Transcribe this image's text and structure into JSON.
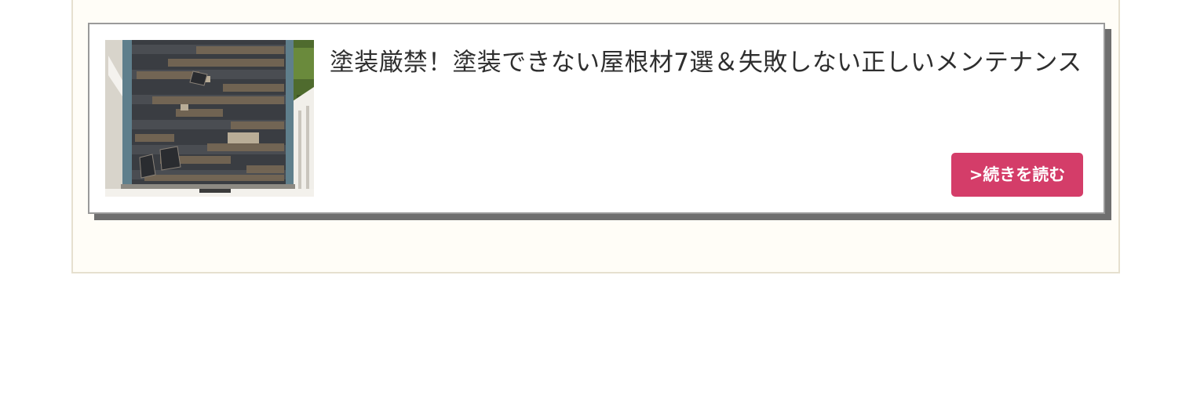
{
  "article_card": {
    "title": "塗装厳禁！塗装できない屋根材7選＆失敗しない正しいメンテナンス",
    "thumbnail_icon": "damaged-roof-photo",
    "read_more_label": ">続きを読む"
  },
  "colors": {
    "panel_bg": "#fffdf7",
    "panel_border": "#e6e0cf",
    "card_border": "#9a9a9a",
    "card_shadow": "#6f6f6f",
    "button_bg": "#d43d69",
    "title_text": "#2e2e2e"
  }
}
